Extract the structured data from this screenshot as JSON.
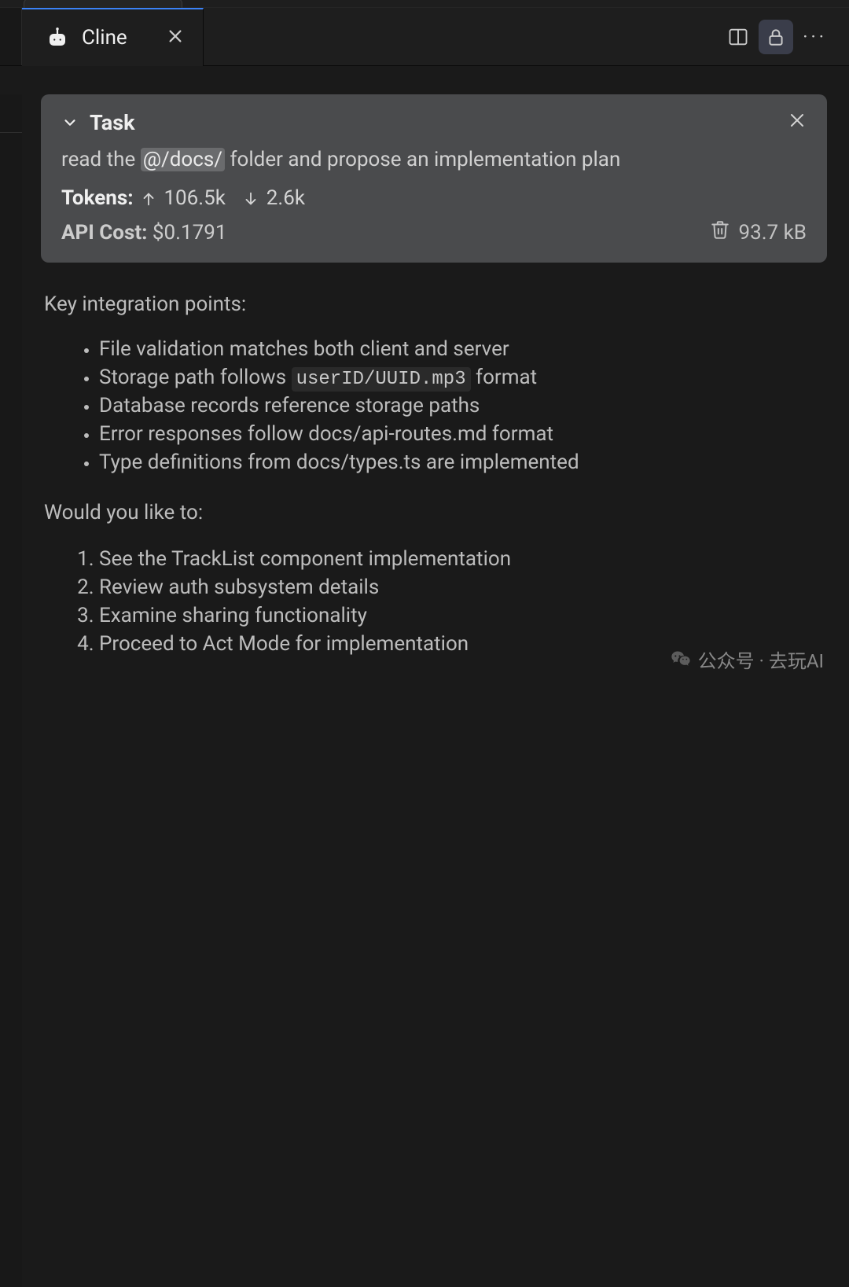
{
  "tab": {
    "title": "Cline"
  },
  "task": {
    "heading": "Task",
    "text_pre": "read the ",
    "text_mention": "@/docs/",
    "text_post": " folder and propose an implementation plan",
    "tokens_label": "Tokens:",
    "tokens_up": "106.5k",
    "tokens_down": "2.6k",
    "cost_label": "API Cost:",
    "cost_value": "$0.1791",
    "size": "93.7 kB"
  },
  "body": {
    "key_points_heading": "Key integration points:",
    "bullets": [
      "File validation matches both client and server",
      {
        "pre": "Storage path follows ",
        "code": "userID/UUID.mp3",
        "post": " format"
      },
      "Database records reference storage paths",
      "Error responses follow docs/api-routes.md format",
      "Type definitions from docs/types.ts are implemented"
    ],
    "prompt_heading": "Would you like to:",
    "options": [
      "See the TrackList component implementation",
      "Review auth subsystem details",
      "Examine sharing functionality",
      "Proceed to Act Mode for implementation"
    ]
  },
  "watermark": {
    "text": "公众号 · 去玩AI"
  }
}
